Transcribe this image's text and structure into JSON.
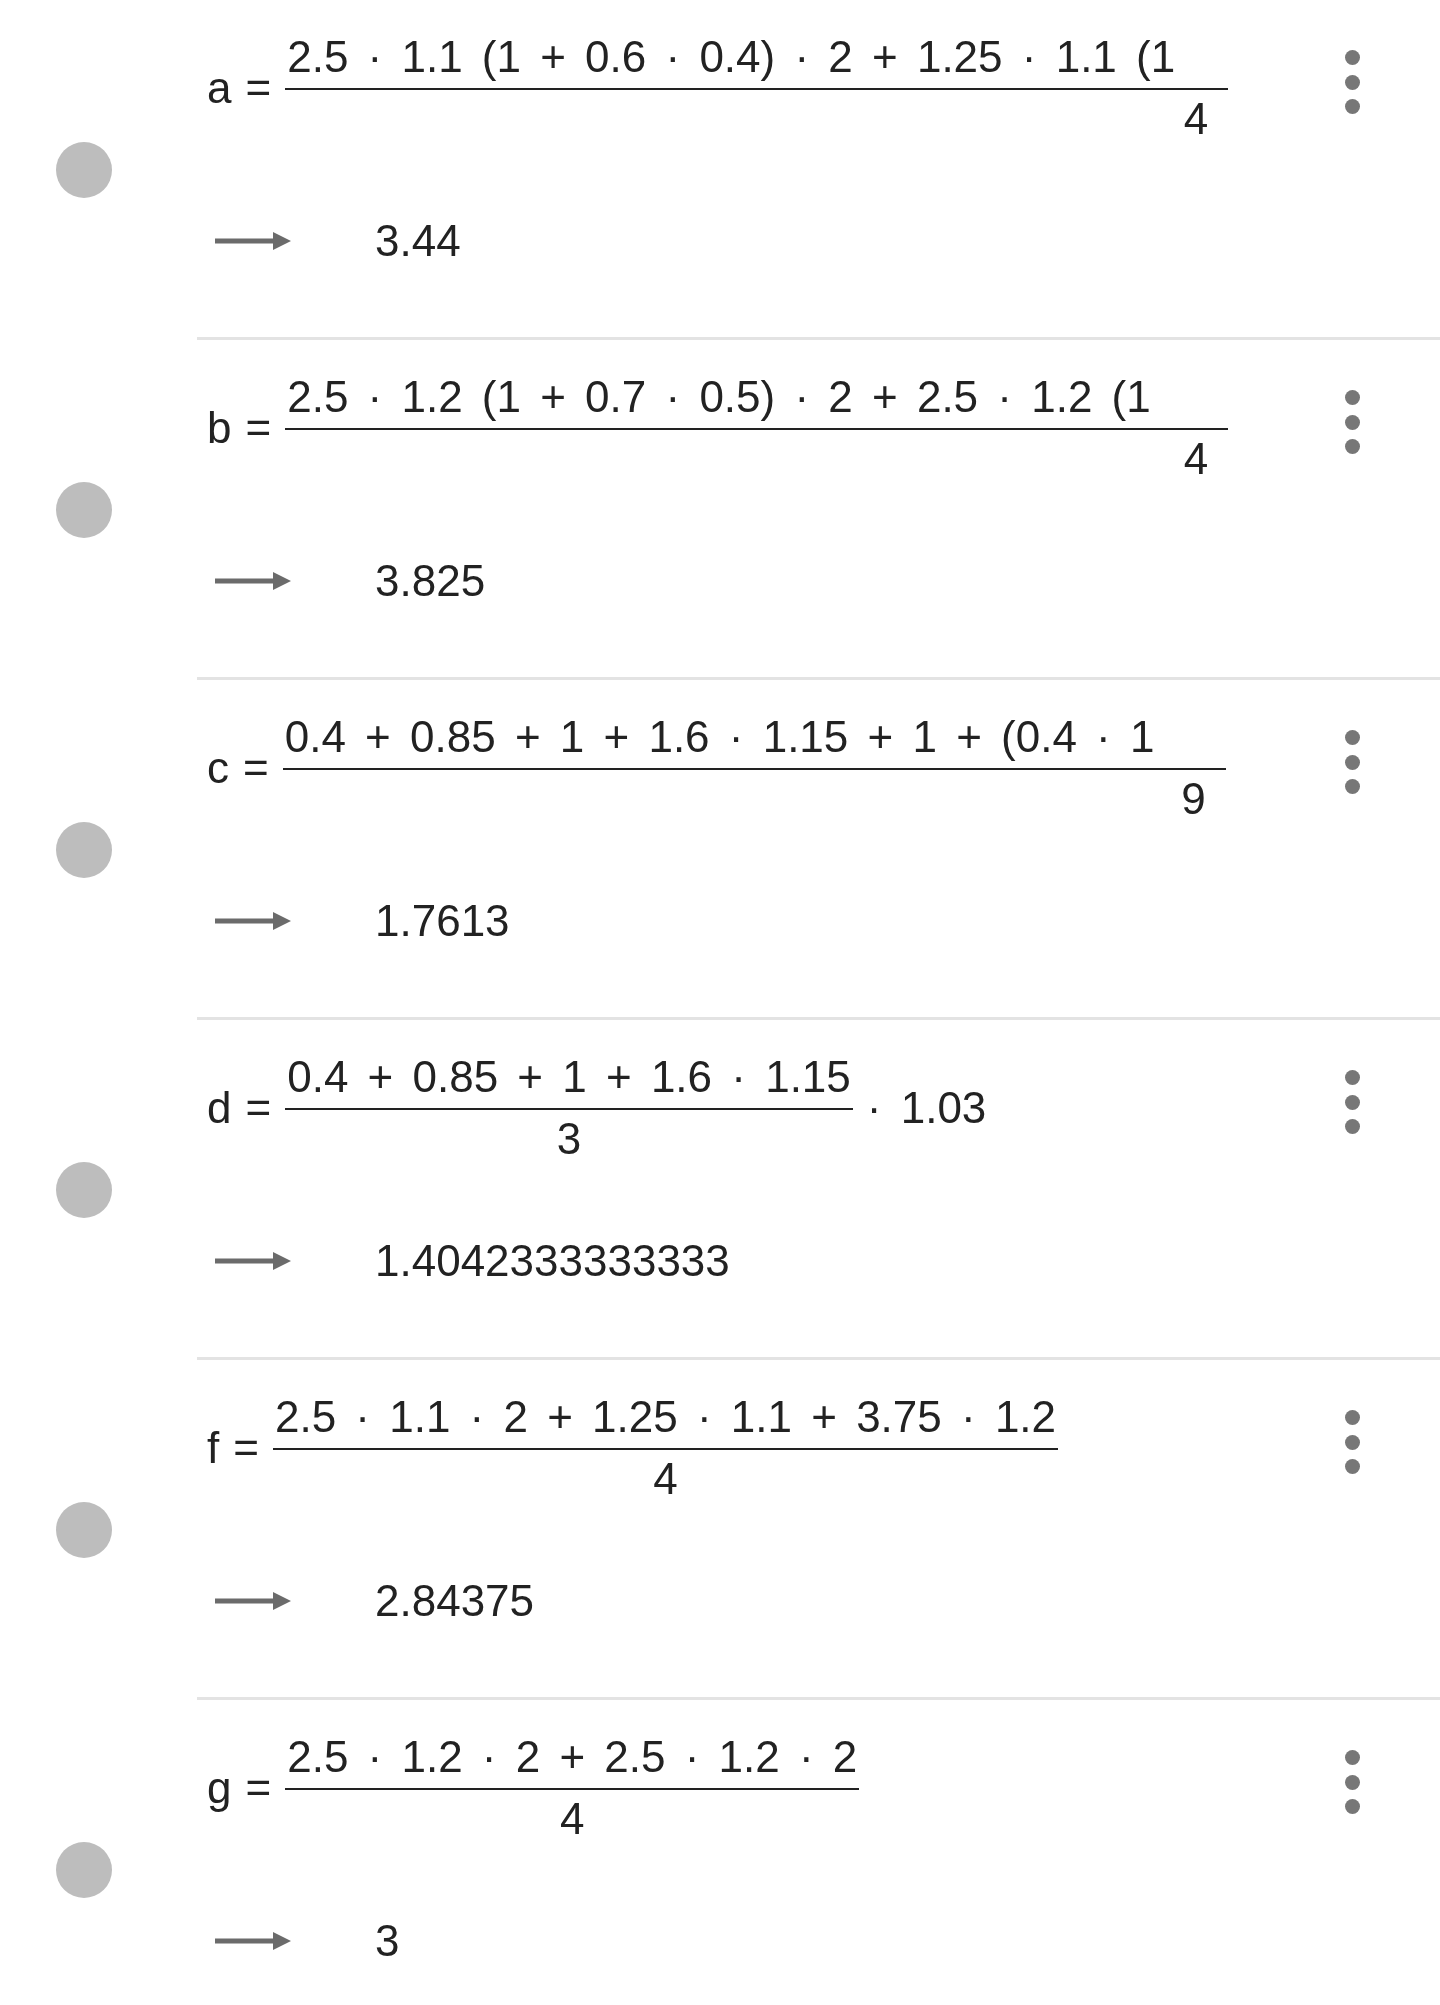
{
  "rows": [
    {
      "name": "a",
      "equals": "=",
      "numerator": "2.5 · 1.1 (1 + 0.6 · 0.4) · 2 + 1.25 · 1.1 (1",
      "denominator": "4",
      "clipped": true,
      "value": "3.44"
    },
    {
      "name": "b",
      "equals": "=",
      "numerator": "2.5 · 1.2 (1 + 0.7 · 0.5) · 2 + 2.5 · 1.2 (1",
      "denominator": "4",
      "clipped": true,
      "value": "3.825"
    },
    {
      "name": "c",
      "equals": "=",
      "numerator": "0.4 + 0.85 + 1 + 1.6 · 1.15 + 1 + (0.4 · 1",
      "denominator": "9",
      "clipped": true,
      "value": "1.7613"
    },
    {
      "name": "d",
      "equals": "=",
      "numerator": "0.4 + 0.85 + 1 + 1.6 · 1.15",
      "denominator": "3",
      "suffix": "· 1.03",
      "clipped": false,
      "value": "1.4042333333333"
    },
    {
      "name": "f",
      "equals": "=",
      "numerator": "2.5 · 1.1 · 2 + 1.25 · 1.1 + 3.75 · 1.2",
      "denominator": "4",
      "clipped": false,
      "value": "2.84375"
    },
    {
      "name": "g",
      "equals": "=",
      "numerator": "2.5 · 1.2 · 2 + 2.5 · 1.2 · 2",
      "denominator": "4",
      "clipped": false,
      "value": "3"
    }
  ]
}
